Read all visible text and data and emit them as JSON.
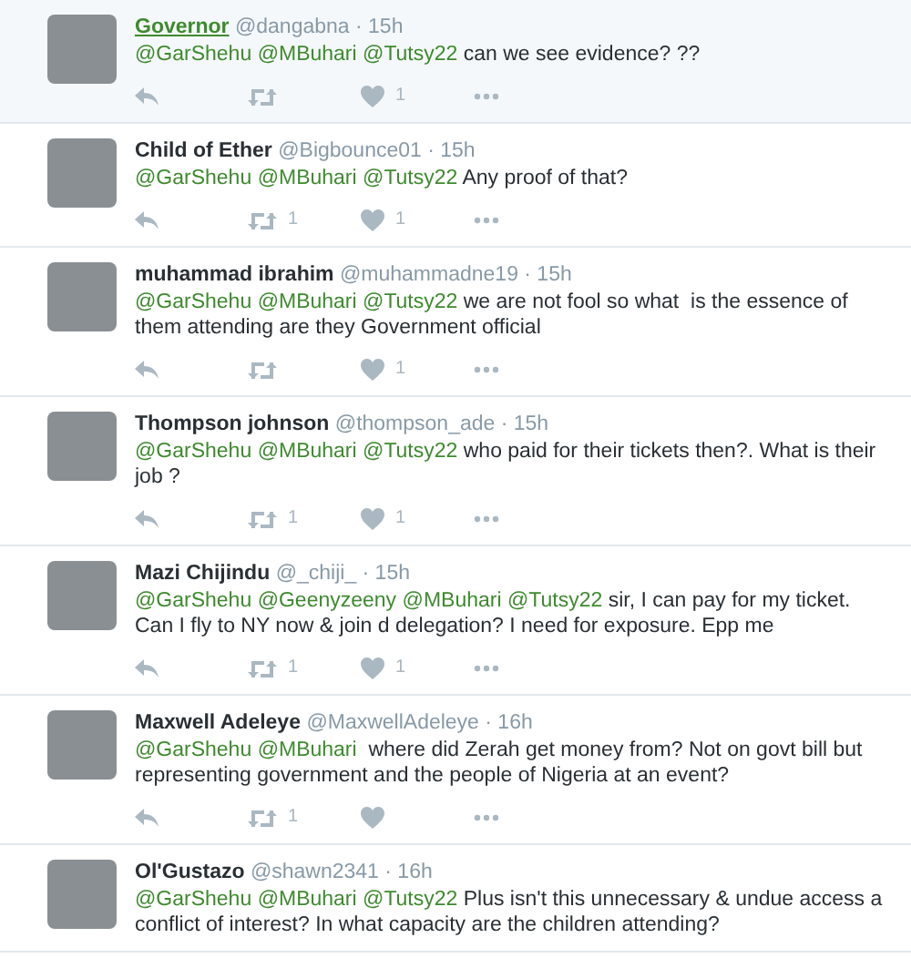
{
  "tweets": [
    {
      "name": "Governor",
      "meta": "@dangabna · 15h",
      "hovered": true,
      "mentions": [
        "@GarShehu",
        "@MBuhari",
        "@Tutsy22"
      ],
      "text": "can we see evidence? ??",
      "actions_shown": true,
      "likes": "1"
    },
    {
      "name": "Child of Ether",
      "meta": "@Bigbounce01 · 15h",
      "hovered": false,
      "mentions": [
        "@GarShehu",
        "@MBuhari",
        "@Tutsy22"
      ],
      "text": "Any proof of that?",
      "actions_shown": true,
      "retweets": "1",
      "likes": "1"
    },
    {
      "name": "muhammad ibrahim",
      "meta": "@muhammadne19 · 15h",
      "hovered": false,
      "mentions": [
        "@GarShehu",
        "@MBuhari",
        "@Tutsy22"
      ],
      "text": "we are not fool so what  is the essence of them attending are they Government official",
      "actions_shown": true,
      "likes": "1"
    },
    {
      "name": "Thompson johnson",
      "meta": "@thompson_ade · 15h",
      "hovered": false,
      "mentions": [
        "@GarShehu",
        "@MBuhari",
        "@Tutsy22"
      ],
      "text": "who paid for their tickets then?. What is their job ?",
      "actions_shown": true,
      "retweets": "1",
      "likes": "1"
    },
    {
      "name": "Mazi Chijindu",
      "meta": "@_chiji_ · 15h",
      "hovered": false,
      "mentions": [
        "@GarShehu",
        "@Geenyzeeny",
        "@MBuhari",
        "@Tutsy22"
      ],
      "text": "sir, I can pay for my ticket. Can I fly to NY now & join d delegation? I need for exposure. Epp me",
      "actions_shown": true,
      "retweets": "1",
      "likes": "1"
    },
    {
      "name": "Maxwell Adeleye",
      "meta": "@MaxwellAdeleye · 16h",
      "hovered": false,
      "mentions": [
        "@GarShehu",
        "@MBuhari"
      ],
      "text": " where did Zerah get money from? Not on govt bill but representing government and the people of Nigeria at an event?",
      "actions_shown": true,
      "retweets": "1"
    },
    {
      "name": "Ol'Gustazo",
      "meta": "@shawn2341 · 16h",
      "hovered": false,
      "mentions": [
        "@GarShehu",
        "@MBuhari",
        "@Tutsy22"
      ],
      "text": "Plus isn't this unnecessary & undue access a conflict of interest? In what capacity are the children attending?",
      "actions_shown": false
    }
  ]
}
